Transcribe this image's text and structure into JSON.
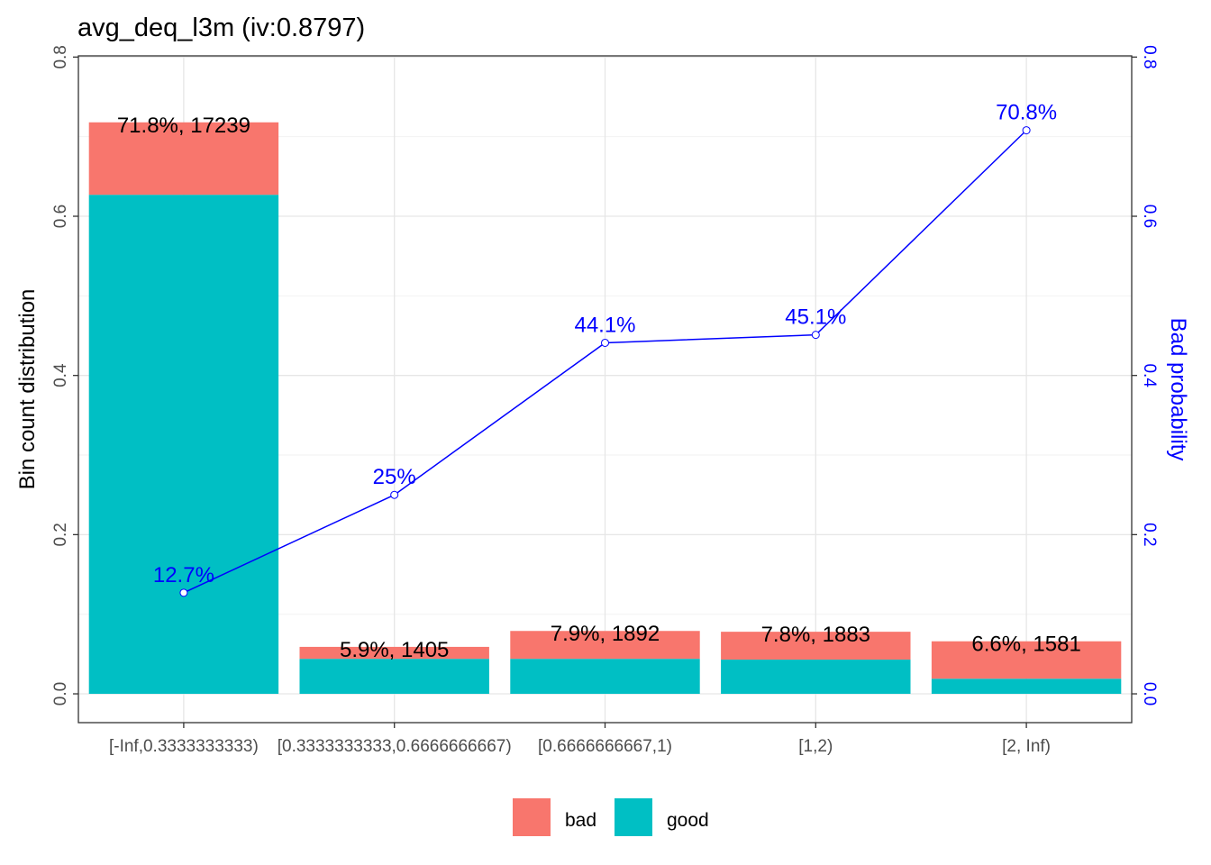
{
  "chart_data": {
    "type": "bar",
    "title": "avg_deq_l3m  (iv:0.8797)",
    "xlabel": "",
    "ylabel": "Bin count distribution",
    "y2label": "Bad probability",
    "ylim": [
      0,
      0.8
    ],
    "y2lim": [
      0,
      0.8
    ],
    "yticks": [
      0.0,
      0.2,
      0.4,
      0.6,
      0.8
    ],
    "ytick_labels": [
      "0.0",
      "0.2",
      "0.4",
      "0.6",
      "0.8"
    ],
    "y2ticks": [
      0.0,
      0.2,
      0.4,
      0.6,
      0.8
    ],
    "y2tick_labels": [
      "0.0",
      "0.2",
      "0.4",
      "0.6",
      "0.8"
    ],
    "grid": true,
    "legend_position": "bottom",
    "categories": [
      "[-Inf,0.3333333333)",
      "[0.3333333333,0.6666666667)",
      "[0.6666666667,1)",
      "[1,2)",
      "[2, Inf)"
    ],
    "series": [
      {
        "name": "bad",
        "color": "#f8766d",
        "values": [
          0.091,
          0.015,
          0.035,
          0.035,
          0.047
        ]
      },
      {
        "name": "good",
        "color": "#00bfc4",
        "values": [
          0.627,
          0.044,
          0.044,
          0.043,
          0.019
        ]
      }
    ],
    "bar_labels": [
      "71.8%, 17239",
      "5.9%, 1405",
      "7.9%, 1892",
      "7.8%, 1883",
      "6.6%, 1581"
    ],
    "bad_probability": {
      "color": "#0000ff",
      "values": [
        0.127,
        0.25,
        0.441,
        0.451,
        0.708
      ],
      "labels": [
        "12.7%",
        "25%",
        "44.1%",
        "45.1%",
        "70.8%"
      ]
    }
  }
}
